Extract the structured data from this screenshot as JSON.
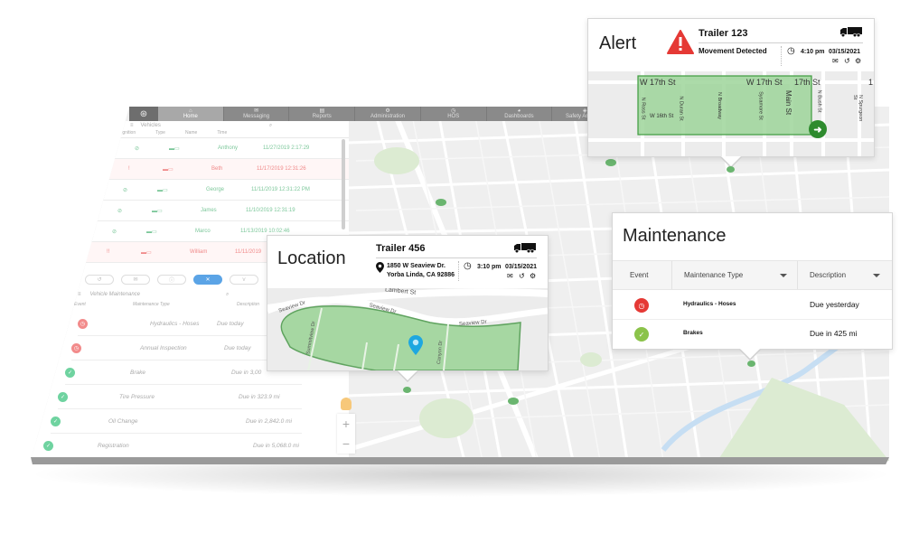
{
  "colors": {
    "accent_green": "#2e8b2e",
    "geofence_fill": "#9ed59a",
    "alert_red": "#e53935",
    "ok_green": "#8bc34a",
    "pin_blue": "#1ea7e0",
    "nav_gray": "#8a8a8a",
    "active_tool_blue": "#5ba4e6"
  },
  "dashboard": {
    "nav": {
      "logo_icon": "steering-wheel-icon",
      "items": [
        {
          "label": "Home",
          "icon": "home-icon",
          "active": true
        },
        {
          "label": "Messaging",
          "icon": "envelope-icon",
          "active": false
        },
        {
          "label": "Reports",
          "icon": "report-icon",
          "active": false
        },
        {
          "label": "Administration",
          "icon": "gears-icon",
          "active": false
        },
        {
          "label": "HOS",
          "icon": "clock-icon",
          "active": false
        },
        {
          "label": "Dashboards",
          "icon": "pie-chart-icon",
          "active": false
        },
        {
          "label": "Safety Analytics",
          "icon": "shield-icon",
          "active": false
        }
      ]
    },
    "vehicles_panel": {
      "title": "Vehicles",
      "columns": [
        "Ignition",
        "Type",
        "Name",
        "Time"
      ],
      "rows": [
        {
          "status": "ok",
          "status_icon": "ignition-off-icon",
          "vehicle_icon": "tractor-trailer-icon",
          "name": "Anthony",
          "time": "11/27/2019 2:17:29"
        },
        {
          "status": "alert",
          "status_icon": "!",
          "vehicle_icon": "tractor-trailer-icon",
          "name": "Beth",
          "time": "11/17/2019 12:31:26"
        },
        {
          "status": "ok",
          "status_icon": "ignition-off-icon",
          "vehicle_icon": "tractor-trailer-icon",
          "name": "George",
          "time": "11/11/2019 12:31:22 PM"
        },
        {
          "status": "ok",
          "status_icon": "ignition-off-icon",
          "vehicle_icon": "pickup-truck-icon",
          "name": "James",
          "time": "11/10/2019 12:31:19"
        },
        {
          "status": "ok",
          "status_icon": "ignition-off-icon",
          "vehicle_icon": "box-truck-icon",
          "name": "Marco",
          "time": "11/13/2019 10:02:46"
        },
        {
          "status": "alert",
          "status_icon": "!!",
          "vehicle_icon": "box-truck-icon",
          "name": "William",
          "time": "11/11/2019"
        }
      ]
    },
    "tools": [
      {
        "icon": "history-icon",
        "active": false
      },
      {
        "icon": "message-icon",
        "active": false
      },
      {
        "icon": "info-icon",
        "active": false
      },
      {
        "icon": "wrench-icon",
        "active": true
      },
      {
        "icon": "filter-icon",
        "active": false
      }
    ],
    "maintenance_panel": {
      "title": "Vehicle Maintenance",
      "columns": [
        "Event",
        "Maintenance Type",
        "Description"
      ],
      "rows": [
        {
          "status": "due",
          "type": "Hydraulics - Hoses",
          "desc": "Due today"
        },
        {
          "status": "due",
          "type": "Annual Inspection",
          "desc": "Due today"
        },
        {
          "status": "ok",
          "type": "Brake",
          "desc": "Due in 3,00"
        },
        {
          "status": "ok",
          "type": "Tire Pressure",
          "desc": "Due in 323.9 mi"
        },
        {
          "status": "ok",
          "type": "Oil Change",
          "desc": "Due in 2,842.0 mi"
        },
        {
          "status": "ok",
          "type": "Registration",
          "desc": "Due in 5,068.0 mi"
        }
      ]
    },
    "zoom": {
      "plus": "+",
      "minus": "−"
    }
  },
  "alert_card": {
    "title": "Alert",
    "icon": "warning-triangle-icon",
    "vehicle": "Trailer 123",
    "event": "Movement Detected",
    "time": "4:10 pm",
    "date": "03/15/2021",
    "streets": {
      "w17_a": "W 17th St",
      "w17_b": "W 17th St",
      "w17_c": "17th St",
      "w16": "W 16th St",
      "ross": "N Ross St",
      "duran": "N Duran St",
      "broadway": "N Broadway",
      "sycamore": "Sycamore St",
      "main": "Main St",
      "bush": "N Bush St",
      "spurgeon": "N Spurgeon St",
      "edge": "1"
    }
  },
  "location_card": {
    "title": "Location",
    "vehicle": "Trailer 456",
    "address_line1": "1850 W Seaview Dr.",
    "address_line2": "Yorba Linda, CA 92886",
    "time": "3:10 pm",
    "date": "03/15/2021",
    "streets": {
      "top": "Lambert St",
      "seaview_a": "Seaview Dr",
      "seaview_b": "Seaview Dr",
      "seaview_c": "Seaview Dr",
      "summitview": "Summitview Dr",
      "canyon": "Canyon Dr"
    }
  },
  "maintenance_card": {
    "title": "Maintenance",
    "columns": [
      "Event",
      "Maintenance Type",
      "Description"
    ],
    "rows": [
      {
        "status": "overdue",
        "status_icon": "clock-icon",
        "type": "Hydraulics - Hoses",
        "desc": "Due yesterday"
      },
      {
        "status": "ok",
        "status_icon": "check-icon",
        "type": "Brakes",
        "desc": "Due in 425 mi"
      }
    ]
  }
}
